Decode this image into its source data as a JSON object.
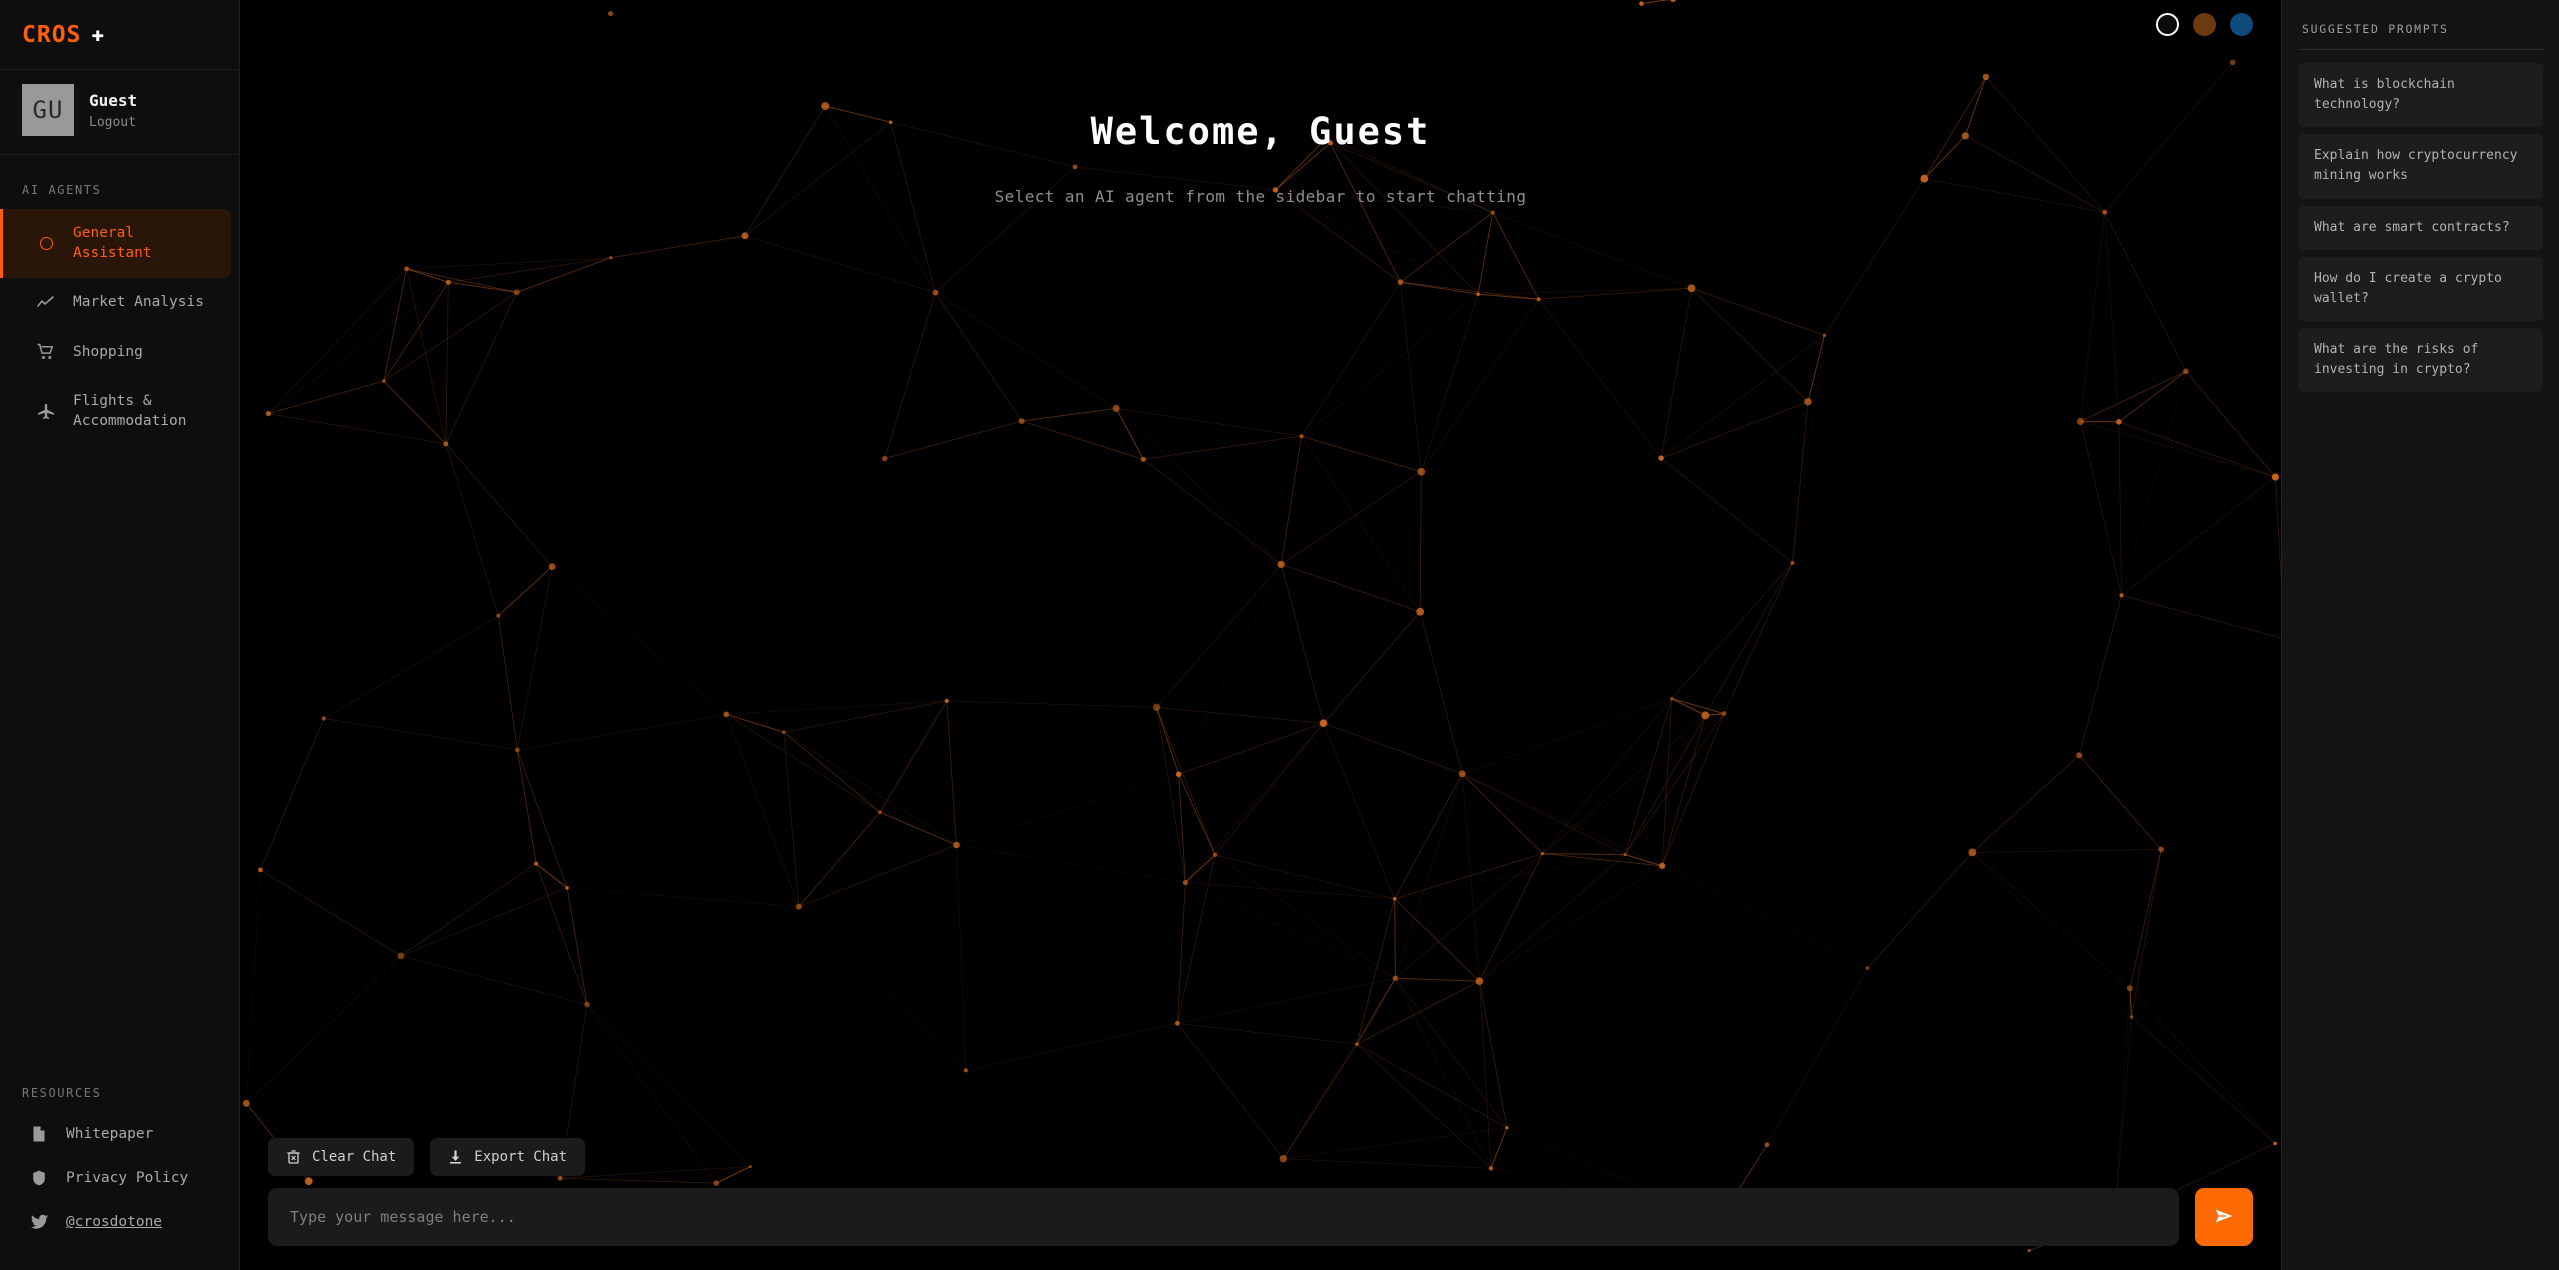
{
  "brand": {
    "name": "CROS",
    "plus_icon": "plus-icon"
  },
  "profile": {
    "avatar_initials": "GU",
    "name": "Guest",
    "logout_label": "Logout"
  },
  "sidebar": {
    "agents_section_label": "AI AGENTS",
    "agents": [
      {
        "label": "General Assistant",
        "icon": "circle-ring-icon",
        "active": true
      },
      {
        "label": "Market Analysis",
        "icon": "chart-line-icon",
        "active": false
      },
      {
        "label": "Shopping",
        "icon": "shopping-cart-icon",
        "active": false
      },
      {
        "label": "Flights & Accommodation",
        "icon": "airplane-icon",
        "active": false
      }
    ],
    "resources_section_label": "RESOURCES",
    "resources": [
      {
        "label": "Whitepaper",
        "icon": "document-icon",
        "link": false
      },
      {
        "label": "Privacy Policy",
        "icon": "shield-icon",
        "link": false
      },
      {
        "label": "@crosdotone",
        "icon": "twitter-icon",
        "link": true
      }
    ]
  },
  "main": {
    "welcome_title": "Welcome, Guest",
    "welcome_subtitle": "Select an AI agent from the sidebar to start chatting",
    "themes": [
      {
        "name": "theme-dark",
        "color": "#0b0b0b",
        "selected": true
      },
      {
        "name": "theme-brown",
        "color": "#6b3a10",
        "selected": false
      },
      {
        "name": "theme-blue",
        "color": "#0e4a7a",
        "selected": false
      }
    ],
    "clear_chat_label": "Clear Chat",
    "export_chat_label": "Export Chat",
    "input_placeholder": "Type your message here...",
    "send_icon": "send-paper-plane-icon"
  },
  "prompts": {
    "title": "SUGGESTED PROMPTS",
    "items": [
      "What is blockchain technology?",
      "Explain how cryptocurrency mining works",
      "What are smart contracts?",
      "How do I create a crypto wallet?",
      "What are the risks of investing in crypto?"
    ]
  },
  "colors": {
    "accent": "#ff5f0a",
    "send_button": "#ff6a00",
    "background": "#000000",
    "sidebar_bg": "#0e0e0e",
    "panel_bg": "#141414",
    "network_node": "#c8661e"
  }
}
